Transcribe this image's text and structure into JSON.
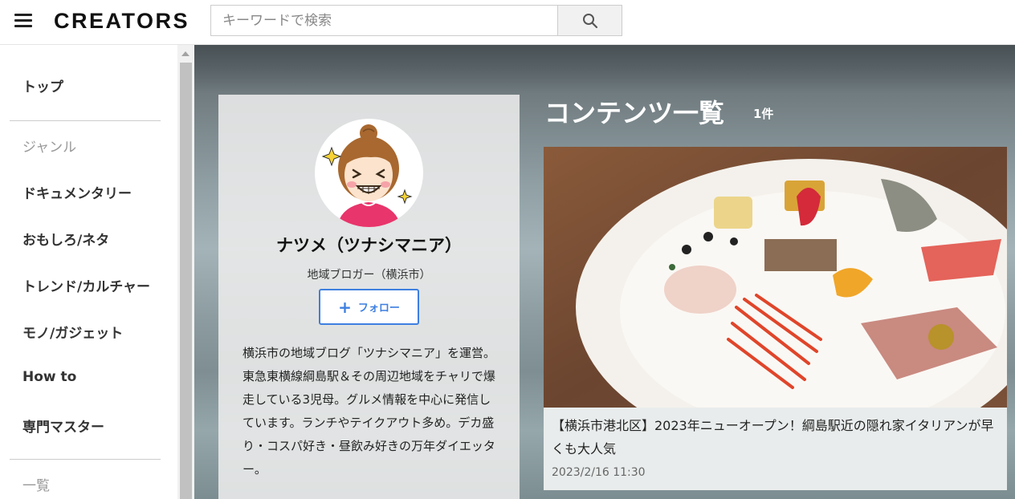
{
  "header": {
    "logo": "CREATORS",
    "search_placeholder": "キーワードで検索"
  },
  "sidebar": {
    "top": "トップ",
    "genre_heading": "ジャンル",
    "genres": [
      "ドキュメンタリー",
      "おもしろ/ネタ",
      "トレンド/カルチャー",
      "モノ/ガジェット",
      "How to",
      "専門マスター"
    ],
    "list_heading": "一覧"
  },
  "profile": {
    "name": "ナツメ（ツナシマニア）",
    "role": "地域ブロガー（横浜市）",
    "follow_label": "フォロー",
    "bio": "横浜市の地域ブログ「ツナシマニア」を運営。東急東横線綱島駅＆その周辺地域をチャリで爆走している3児母。グルメ情報を中心に発信しています。ランチやテイクアウト多め。デカ盛り・コスパ好き・昼飲み好きの万年ダイエッター。"
  },
  "content": {
    "section_title": "コンテンツ一覧",
    "count": "1件",
    "items": [
      {
        "title": "【横浜市港北区】2023年ニューオープン！綱島駅近の隠れ家イタリアンが早くも大人気",
        "date": "2023/2/16 11:30"
      }
    ]
  },
  "colors": {
    "accent": "#3e7fe0",
    "text": "#333333",
    "muted": "#999999"
  }
}
